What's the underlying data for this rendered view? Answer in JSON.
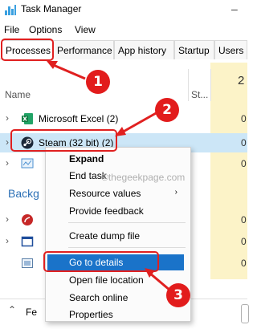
{
  "window": {
    "title": "Task Manager",
    "partial_right_glyph": "–"
  },
  "menu": [
    "File",
    "Options",
    "View"
  ],
  "tabs": [
    "Processes",
    "Performance",
    "App history",
    "Startup",
    "Users"
  ],
  "columns": {
    "name": "Name",
    "status": "St...",
    "cpu_header": "2"
  },
  "rows": [
    {
      "name": "Microsoft Excel (2)",
      "cpu": "0"
    },
    {
      "name": "Steam (32 bit) (2)",
      "cpu": "0"
    },
    {
      "name": "",
      "cpu": "0"
    },
    {
      "name": "",
      "cpu": "0"
    },
    {
      "name": "",
      "cpu": "0"
    },
    {
      "name": "",
      "cpu": "0"
    }
  ],
  "section": {
    "background": "Backg"
  },
  "context_menu": {
    "items": [
      "Expand",
      "End task",
      "Resource values",
      "Provide feedback",
      "Create dump file",
      "Go to details",
      "Open file location",
      "Search online",
      "Properties"
    ],
    "submenu_arrow": "›"
  },
  "footer": {
    "fewer_details": "Fe"
  },
  "watermark": "©thegeekpage.com",
  "badges": [
    "1",
    "2",
    "3"
  ],
  "colors": {
    "annotation_red": "#e02020",
    "selection_blue": "#cce6f7",
    "menu_highlight": "#1a73c9",
    "cpu_col": "#fcf3c8"
  }
}
